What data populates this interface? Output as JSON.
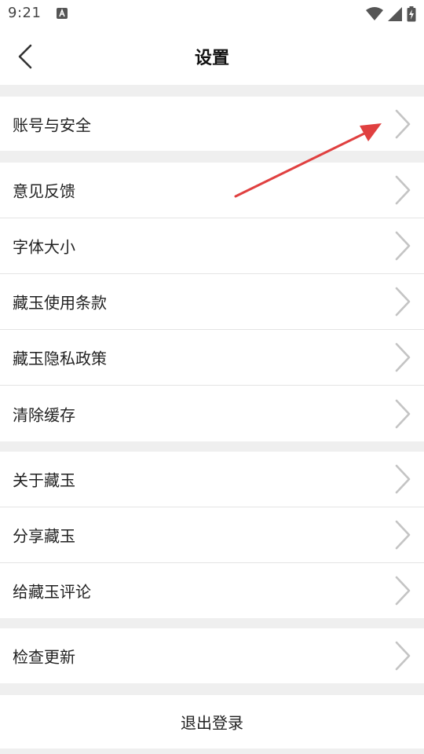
{
  "status_bar": {
    "time": "9:21",
    "left_icon": "a-notification-icon",
    "right_icons": [
      "wifi-icon",
      "signal-icon",
      "battery-charging-icon"
    ]
  },
  "header": {
    "back_icon": "chevron-left-icon",
    "title": "设置"
  },
  "groups": [
    {
      "items": [
        {
          "label": "账号与安全"
        }
      ]
    },
    {
      "items": [
        {
          "label": "意见反馈"
        },
        {
          "label": "字体大小"
        },
        {
          "label": "藏玉使用条款"
        },
        {
          "label": "藏玉隐私政策"
        },
        {
          "label": "清除缓存"
        }
      ]
    },
    {
      "items": [
        {
          "label": "关于藏玉"
        },
        {
          "label": "分享藏玉"
        },
        {
          "label": "给藏玉评论"
        }
      ]
    },
    {
      "items": [
        {
          "label": "检查更新"
        }
      ]
    }
  ],
  "logout": {
    "label": "退出登录"
  },
  "colors": {
    "background": "#efefef",
    "card": "#ffffff",
    "chevron": "#c4c4c4",
    "annotation_arrow": "#e04040"
  }
}
